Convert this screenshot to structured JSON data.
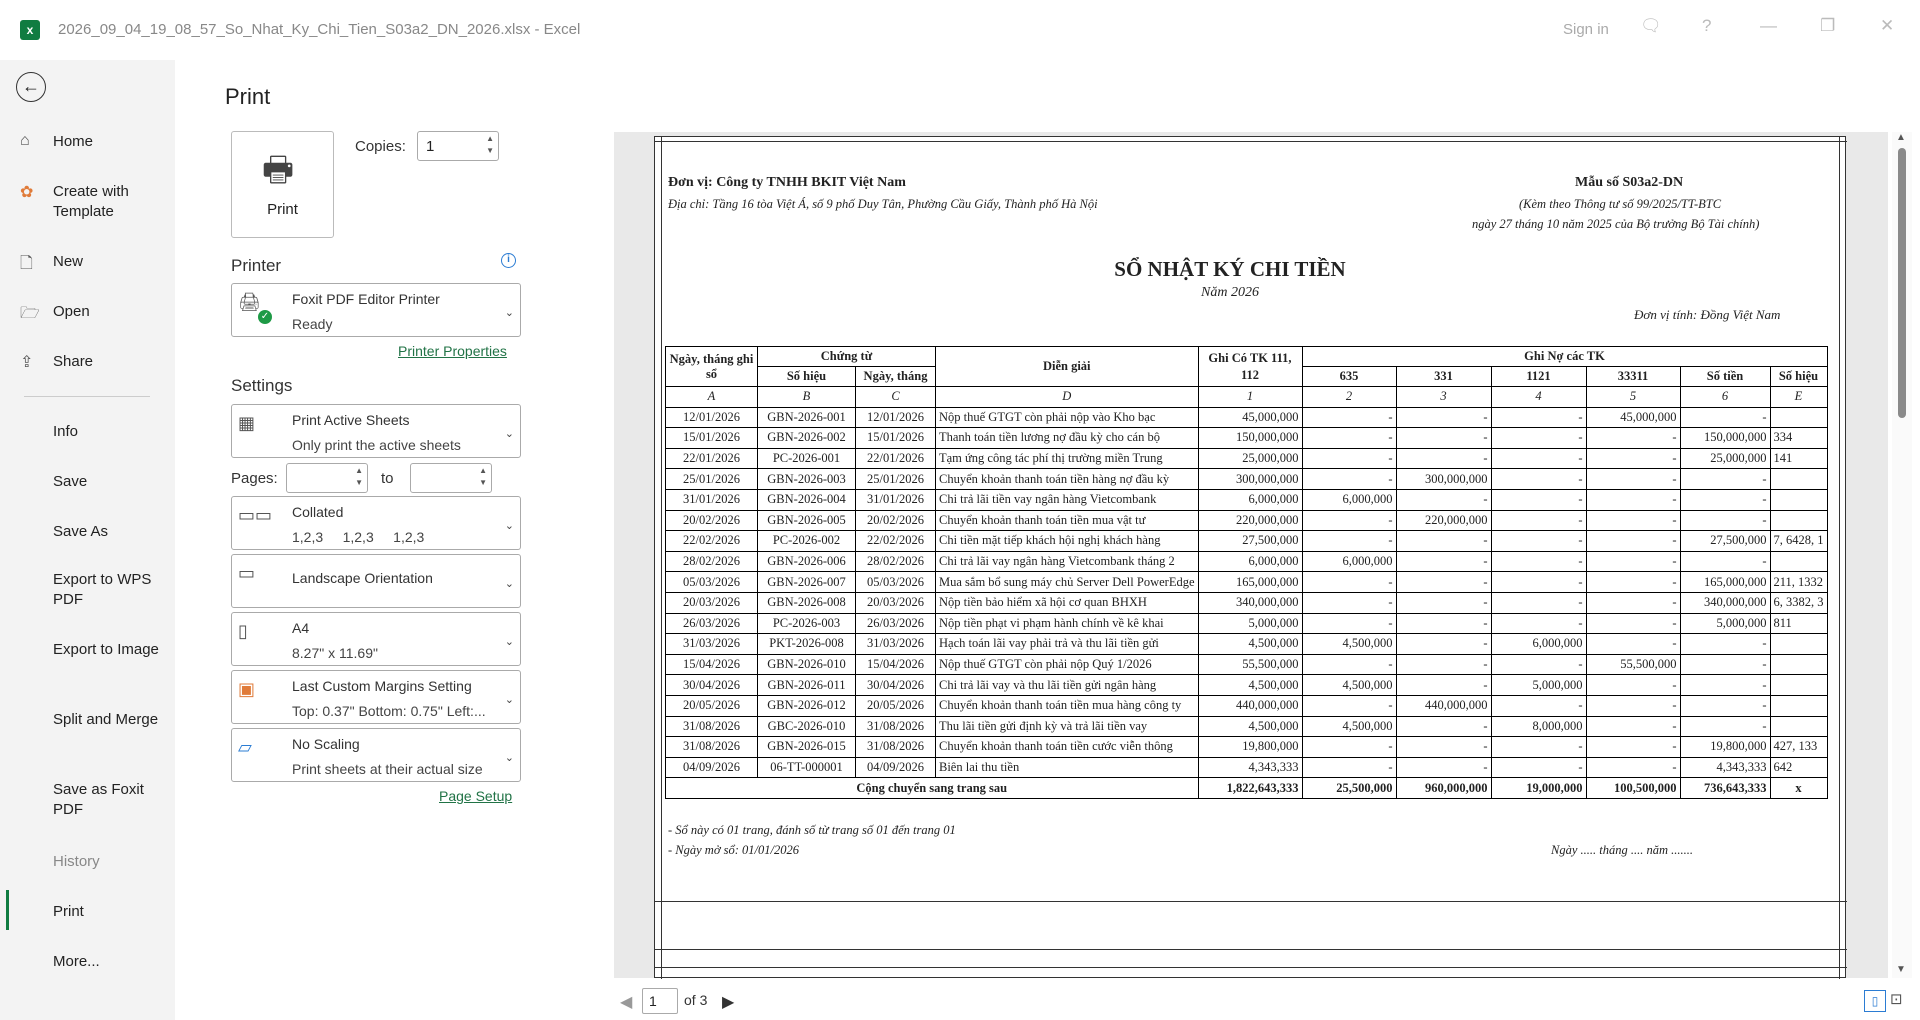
{
  "window": {
    "title": "2026_09_04_19_08_57_So_Nhat_Ky_Chi_Tien_S03a2_DN_2026.xlsx  -  Excel",
    "signin": "Sign in",
    "help": "?"
  },
  "nav": {
    "back": "←",
    "items": [
      {
        "label": "Home",
        "icon": "home-icon"
      },
      {
        "label": "Create with Template",
        "icon": "template-icon"
      },
      {
        "label": "New",
        "icon": "new-file-icon"
      },
      {
        "label": "Open",
        "icon": "folder-open-icon"
      },
      {
        "label": "Share",
        "icon": "share-icon"
      },
      {
        "label": "Info"
      },
      {
        "label": "Save"
      },
      {
        "label": "Save As"
      },
      {
        "label": "Export to WPS PDF"
      },
      {
        "label": "Export to Image"
      },
      {
        "label": "Split and Merge"
      },
      {
        "label": "Save as Foxit PDF"
      },
      {
        "label": "History"
      },
      {
        "label": "Print",
        "active": true
      },
      {
        "label": "More..."
      }
    ]
  },
  "print": {
    "title": "Print",
    "button": "Print",
    "copies_label": "Copies:",
    "copies": "1",
    "printer_section": "Printer",
    "printer_name": "Foxit PDF Editor Printer",
    "printer_status": "Ready",
    "printer_properties": "Printer Properties",
    "settings_section": "Settings",
    "what_l1": "Print Active Sheets",
    "what_l2": "Only print the active sheets",
    "pages_label": "Pages:",
    "pages_to": "to",
    "collate_l1": "Collated",
    "collate_l2": "1,2,3     1,2,3     1,2,3",
    "orient_l1": "Landscape Orientation",
    "paper_l1": "A4",
    "paper_l2": "8.27\" x 11.69\"",
    "margins_l1": "Last Custom Margins Setting",
    "margins_l2": "Top: 0.37\" Bottom: 0.75\" Left:...",
    "scale_l1": "No Scaling",
    "scale_l2": "Print sheets at their actual size",
    "page_setup": "Page Setup"
  },
  "preview": {
    "page_number": "1",
    "page_total": "of 3"
  },
  "sheet": {
    "unit": "Đơn vị: Công ty TNHH BKIT Việt Nam",
    "address": "Địa chỉ: Tầng 16 tòa Việt Á, số 9 phố Duy Tân, Phường Cầu Giấy, Thành phố Hà Nội",
    "form_no": "Mẫu số S03a2-DN",
    "circular": "(Kèm theo Thông tư số 99/2025/TT-BTC",
    "circular_date": "ngày 27 tháng 10 năm 2025 của Bộ trưởng Bộ Tài chính)",
    "title": "SỔ NHẬT KÝ CHI TIỀN",
    "year": "Năm 2026",
    "currency": "Đơn vị tính: Đồng Việt Nam",
    "headers": {
      "date": "Ngày, tháng ghi sổ",
      "voucher": "Chứng từ",
      "voucher_no": "Số hiệu",
      "voucher_date": "Ngày, tháng",
      "desc": "Diễn giải",
      "credit": "Ghi Có TK 111, 112",
      "debit": "Ghi Nợ các TK",
      "c635": "635",
      "c331": "331",
      "c1121": "1121",
      "c33311": "33311",
      "amount": "Số tiền",
      "acct": "Số hiệu"
    },
    "letters": [
      "A",
      "B",
      "C",
      "D",
      "1",
      "2",
      "3",
      "4",
      "5",
      "6",
      "E"
    ],
    "rows": [
      [
        "12/01/2026",
        "GBN-2026-001",
        "12/01/2026",
        "Nộp thuế GTGT còn phải nộp vào Kho bạc",
        "45,000,000",
        "-",
        "-",
        "-",
        "45,000,000",
        "-",
        ""
      ],
      [
        "15/01/2026",
        "GBN-2026-002",
        "15/01/2026",
        "Thanh toán tiền lương nợ đầu kỳ cho cán bộ",
        "150,000,000",
        "-",
        "-",
        "-",
        "-",
        "150,000,000",
        "334"
      ],
      [
        "22/01/2026",
        "PC-2026-001",
        "22/01/2026",
        "Tạm ứng công tác phí thị trường miền Trung",
        "25,000,000",
        "-",
        "-",
        "-",
        "-",
        "25,000,000",
        "141"
      ],
      [
        "25/01/2026",
        "GBN-2026-003",
        "25/01/2026",
        "Chuyển khoản thanh toán tiền hàng nợ đầu kỳ",
        "300,000,000",
        "-",
        "300,000,000",
        "-",
        "-",
        "-",
        ""
      ],
      [
        "31/01/2026",
        "GBN-2026-004",
        "31/01/2026",
        "Chi trả lãi tiền vay ngân hàng Vietcombank",
        "6,000,000",
        "6,000,000",
        "-",
        "-",
        "-",
        "-",
        ""
      ],
      [
        "20/02/2026",
        "GBN-2026-005",
        "20/02/2026",
        "Chuyển khoản thanh toán tiền mua vật tư",
        "220,000,000",
        "-",
        "220,000,000",
        "-",
        "-",
        "-",
        ""
      ],
      [
        "22/02/2026",
        "PC-2026-002",
        "22/02/2026",
        "Chi tiền mặt tiếp khách hội nghị khách hàng",
        "27,500,000",
        "-",
        "-",
        "-",
        "-",
        "27,500,000",
        "7, 6428, 1"
      ],
      [
        "28/02/2026",
        "GBN-2026-006",
        "28/02/2026",
        "Chi trả lãi vay ngân hàng Vietcombank tháng 2",
        "6,000,000",
        "6,000,000",
        "-",
        "-",
        "-",
        "-",
        ""
      ],
      [
        "05/03/2026",
        "GBN-2026-007",
        "05/03/2026",
        "Mua sắm bổ sung máy chủ Server Dell PowerEdge",
        "165,000,000",
        "-",
        "-",
        "-",
        "-",
        "165,000,000",
        "211, 1332"
      ],
      [
        "20/03/2026",
        "GBN-2026-008",
        "20/03/2026",
        "Nộp tiền bảo hiểm xã hội cơ quan BHXH",
        "340,000,000",
        "-",
        "-",
        "-",
        "-",
        "340,000,000",
        "6, 3382, 3"
      ],
      [
        "26/03/2026",
        "PC-2026-003",
        "26/03/2026",
        "Nộp tiền phạt vi phạm hành chính về kê khai",
        "5,000,000",
        "-",
        "-",
        "-",
        "-",
        "5,000,000",
        "811"
      ],
      [
        "31/03/2026",
        "PKT-2026-008",
        "31/03/2026",
        "Hạch toán lãi vay phải trả và thu lãi tiền gửi",
        "4,500,000",
        "4,500,000",
        "-",
        "6,000,000",
        "-",
        "-",
        ""
      ],
      [
        "15/04/2026",
        "GBN-2026-010",
        "15/04/2026",
        "Nộp thuế GTGT còn phải nộp Quý 1/2026",
        "55,500,000",
        "-",
        "-",
        "-",
        "55,500,000",
        "-",
        ""
      ],
      [
        "30/04/2026",
        "GBN-2026-011",
        "30/04/2026",
        "Chi trả lãi vay và thu lãi tiền gửi ngân hàng",
        "4,500,000",
        "4,500,000",
        "-",
        "5,000,000",
        "-",
        "-",
        ""
      ],
      [
        "20/05/2026",
        "GBN-2026-012",
        "20/05/2026",
        "Chuyển khoản thanh toán tiền mua hàng công ty",
        "440,000,000",
        "-",
        "440,000,000",
        "-",
        "-",
        "-",
        ""
      ],
      [
        "31/08/2026",
        "GBC-2026-010",
        "31/08/2026",
        "Thu lãi tiền gửi định kỳ và trả lãi tiền vay",
        "4,500,000",
        "4,500,000",
        "-",
        "8,000,000",
        "-",
        "-",
        ""
      ],
      [
        "31/08/2026",
        "GBN-2026-015",
        "31/08/2026",
        "Chuyển khoản thanh toán tiền cước viễn thông",
        "19,800,000",
        "-",
        "-",
        "-",
        "-",
        "19,800,000",
        "427, 133"
      ],
      [
        "04/09/2026",
        "06-TT-000001",
        "04/09/2026",
        "Biên lai thu tiền",
        "4,343,333",
        "-",
        "-",
        "-",
        "-",
        "4,343,333",
        "642"
      ]
    ],
    "total": {
      "label": "Cộng chuyển sang trang sau",
      "values": [
        "1,822,643,333",
        "25,500,000",
        "960,000,000",
        "19,000,000",
        "100,500,000",
        "736,643,333",
        "x"
      ]
    },
    "footer_pages": "- Sổ này có 01 trang, đánh số từ trang số 01 đến trang 01",
    "footer_open": "- Ngày mở sổ: 01/01/2026",
    "footer_date": "Ngày ..... tháng .... năm ......."
  }
}
